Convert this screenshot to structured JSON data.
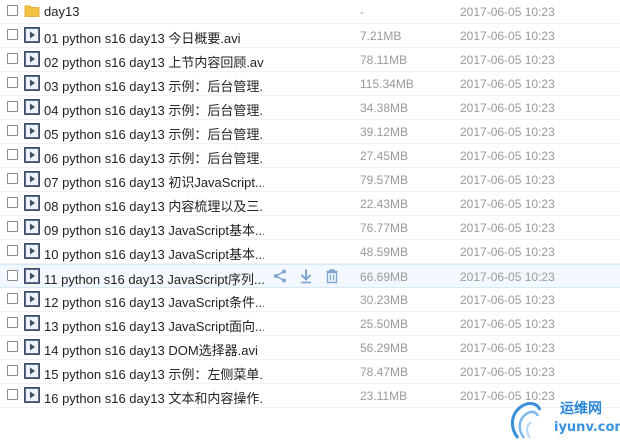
{
  "files": [
    {
      "name": "day13",
      "size": "-",
      "date": "2017-06-05 10:23",
      "icon": "folder-icon"
    },
    {
      "name": "01 python s16 day13 今日概要.avi",
      "size": "7.21MB",
      "date": "2017-06-05 10:23",
      "icon": "video-file-icon"
    },
    {
      "name": "02 python s16 day13 上节内容回顾.avi",
      "size": "78.11MB",
      "date": "2017-06-05 10:23",
      "icon": "video-file-icon"
    },
    {
      "name": "03 python s16 day13 示例：后台管理...",
      "size": "115.34MB",
      "date": "2017-06-05 10:23",
      "icon": "video-file-icon"
    },
    {
      "name": "04 python s16 day13 示例：后台管理...",
      "size": "34.38MB",
      "date": "2017-06-05 10:23",
      "icon": "video-file-icon"
    },
    {
      "name": "05 python s16 day13 示例：后台管理...",
      "size": "39.12MB",
      "date": "2017-06-05 10:23",
      "icon": "video-file-icon"
    },
    {
      "name": "06 python s16 day13 示例：后台管理...",
      "size": "27.45MB",
      "date": "2017-06-05 10:23",
      "icon": "video-file-icon"
    },
    {
      "name": "07 python s16 day13 初识JavaScript...",
      "size": "79.57MB",
      "date": "2017-06-05 10:23",
      "icon": "video-file-icon"
    },
    {
      "name": "08 python s16 day13 内容梳理以及三...",
      "size": "22.43MB",
      "date": "2017-06-05 10:23",
      "icon": "video-file-icon"
    },
    {
      "name": "09 python s16 day13 JavaScript基本...",
      "size": "76.77MB",
      "date": "2017-06-05 10:23",
      "icon": "video-file-icon"
    },
    {
      "name": "10 python s16 day13 JavaScript基本...",
      "size": "48.59MB",
      "date": "2017-06-05 10:23",
      "icon": "video-file-icon"
    },
    {
      "name": "11 python s16 day13 JavaScript序列...",
      "size": "66.69MB",
      "date": "2017-06-05 10:23",
      "icon": "video-file-icon"
    },
    {
      "name": "12 python s16 day13 JavaScript条件...",
      "size": "30.23MB",
      "date": "2017-06-05 10:23",
      "icon": "video-file-icon"
    },
    {
      "name": "13 python s16 day13 JavaScript面向...",
      "size": "25.50MB",
      "date": "2017-06-05 10:23",
      "icon": "video-file-icon"
    },
    {
      "name": "14 python s16 day13 DOM选择器.avi",
      "size": "56.29MB",
      "date": "2017-06-05 10:23",
      "icon": "video-file-icon"
    },
    {
      "name": "15 python s16 day13 示例：左侧菜单...",
      "size": "78.47MB",
      "date": "2017-06-05 10:23",
      "icon": "video-file-icon"
    },
    {
      "name": "16 python s16 day13 文本和内容操作...",
      "size": "23.11MB",
      "date": "2017-06-05 10:23",
      "icon": "video-file-icon"
    }
  ],
  "hover_actions": [
    "share-icon",
    "download-icon",
    "delete-icon"
  ],
  "watermark": {
    "line1": "运维网",
    "line2": "iyunv.com"
  },
  "colors": {
    "row_hover": "#f2f8fd",
    "folder": "#f5c042",
    "video_icon": "#5a6b8c",
    "muted_text": "#9a9a9a"
  }
}
